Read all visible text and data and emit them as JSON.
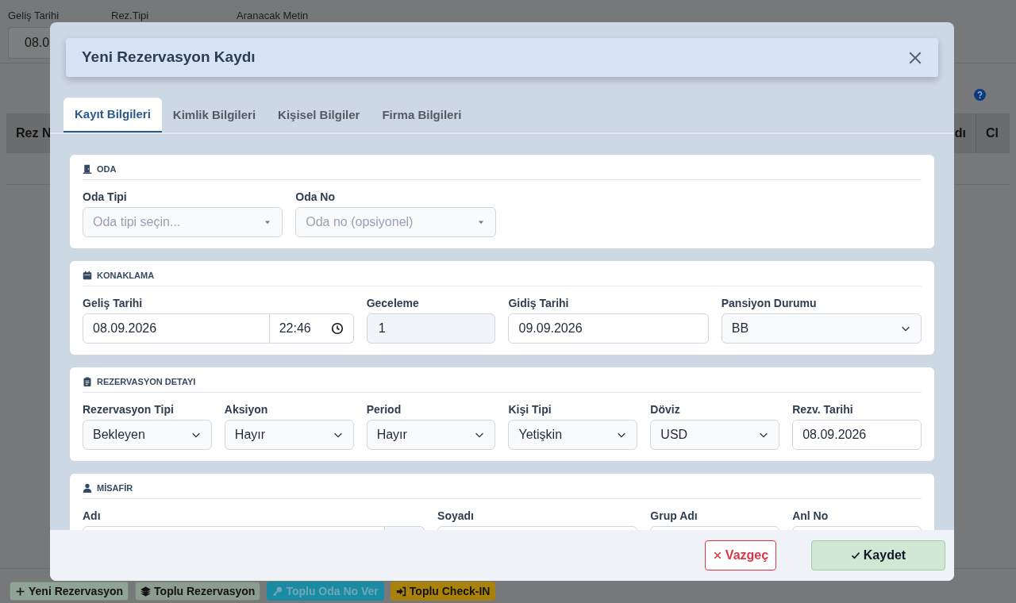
{
  "background": {
    "filters": [
      {
        "label": "Geliş Tarihi",
        "value": "08.0"
      },
      {
        "label": "Rez.Tipi"
      },
      {
        "label": "Aranacak Metin"
      }
    ],
    "table": {
      "columns": [
        "Rez N",
        "dı",
        "Cl"
      ]
    },
    "toolbar": [
      {
        "label": "Yeni Rezervasyon"
      },
      {
        "label": "Toplu Rezervasyon"
      },
      {
        "label": "Toplu Oda No Ver"
      },
      {
        "label": "Toplu Check-IN"
      }
    ]
  },
  "modal": {
    "title": "Yeni Rezervasyon Kaydı",
    "tabs": [
      {
        "label": "Kayıt Bilgileri",
        "selected": true
      },
      {
        "label": "Kimlik Bilgileri",
        "selected": false
      },
      {
        "label": "Kişisel Bilgiler",
        "selected": false
      },
      {
        "label": "Firma Bilgileri",
        "selected": false
      }
    ],
    "sections": [
      {
        "title": "ODA",
        "fields": [
          {
            "label": "Oda Tipi",
            "kind": "combo",
            "placeholder": "Oda tipi seçin..."
          },
          {
            "label": "Oda No",
            "kind": "combo",
            "placeholder": "Oda no (opsiyonel)"
          }
        ]
      },
      {
        "title": "KONAKLAMA",
        "fields": [
          {
            "label": "Geliş Tarihi",
            "kind": "datetime",
            "value": "08.09.2026",
            "time": "22:46"
          },
          {
            "label": "Geceleme",
            "kind": "readonly",
            "value": "1"
          },
          {
            "label": "Gidiş Tarihi",
            "kind": "text",
            "value": "09.09.2026"
          },
          {
            "label": "Pansiyon Durumu",
            "kind": "select",
            "value": "BB"
          }
        ]
      },
      {
        "title": "REZERVASYON DETAYI",
        "fields": [
          {
            "label": "Rezervasyon Tipi",
            "kind": "select",
            "value": "Bekleyen"
          },
          {
            "label": "Aksiyon",
            "kind": "select",
            "value": "Hayır"
          },
          {
            "label": "Period",
            "kind": "select",
            "value": "Hayır"
          },
          {
            "label": "Kişi Tipi",
            "kind": "select",
            "value": "Yetişkin"
          },
          {
            "label": "Döviz",
            "kind": "select",
            "value": "USD"
          },
          {
            "label": "Rezv. Tarihi",
            "kind": "text",
            "value": "08.09.2026"
          }
        ]
      },
      {
        "title": "MİSAFİR",
        "fields": [
          {
            "label": "Adı",
            "kind": "addon"
          },
          {
            "label": "Soyadı",
            "kind": "text"
          },
          {
            "label": "Grup Adı",
            "kind": "text"
          },
          {
            "label": "Anl No",
            "kind": "text"
          }
        ]
      }
    ],
    "buttons": [
      {
        "label": "Vazgeç",
        "kind": "cancel"
      },
      {
        "label": "Kaydet",
        "kind": "save"
      }
    ]
  }
}
